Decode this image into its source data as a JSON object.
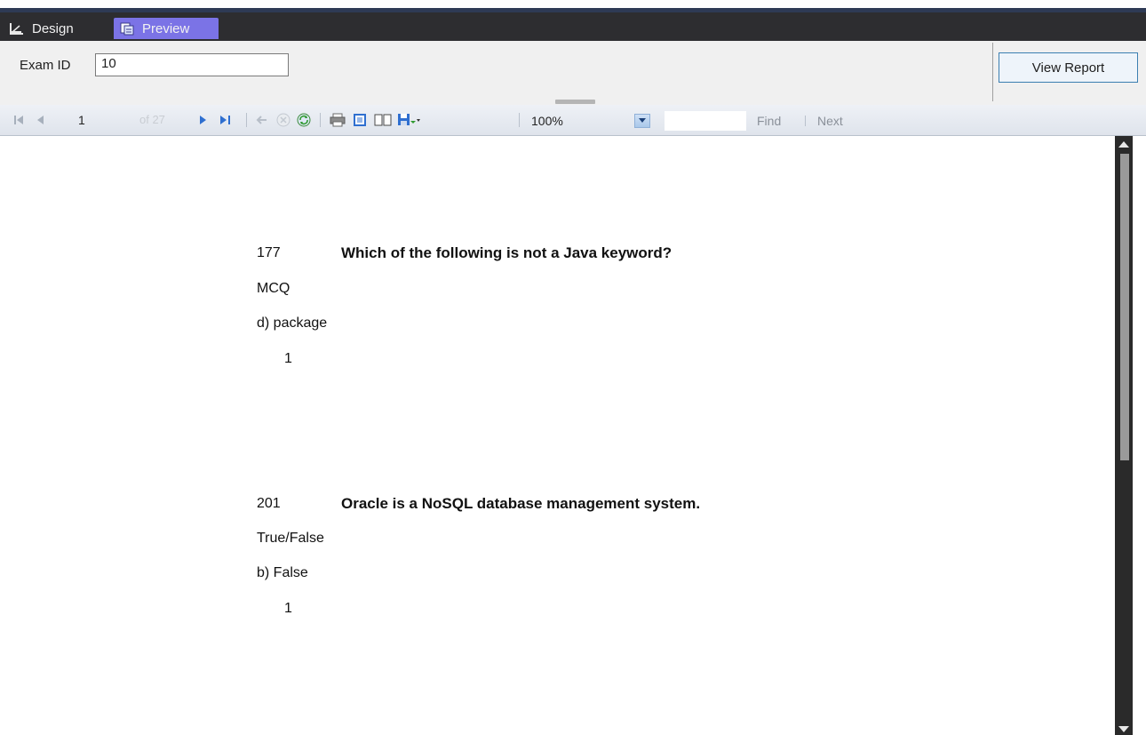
{
  "tabs": {
    "design_label": "Design",
    "preview_label": "Preview"
  },
  "params": {
    "exam_id_label": "Exam ID",
    "exam_id_value": "10",
    "view_report_label": "View Report"
  },
  "toolbar": {
    "page_current": "1",
    "page_of": "of 27",
    "zoom_value": "100%",
    "find_label": "Find",
    "next_label": "Next"
  },
  "report": {
    "questions": [
      {
        "number": "177",
        "text": "Which of the following is not a Java keyword?",
        "type": "MCQ",
        "answer": "d) package",
        "marks": "1"
      },
      {
        "number": "201",
        "text": "Oracle is a NoSQL database management system.",
        "type": "True/False",
        "answer": "b) False",
        "marks": "1"
      }
    ]
  },
  "colors": {
    "tabbar_bg": "#2d2d30",
    "preview_tab": "#7b73e6",
    "scrollbar": "#2a2a2a"
  }
}
